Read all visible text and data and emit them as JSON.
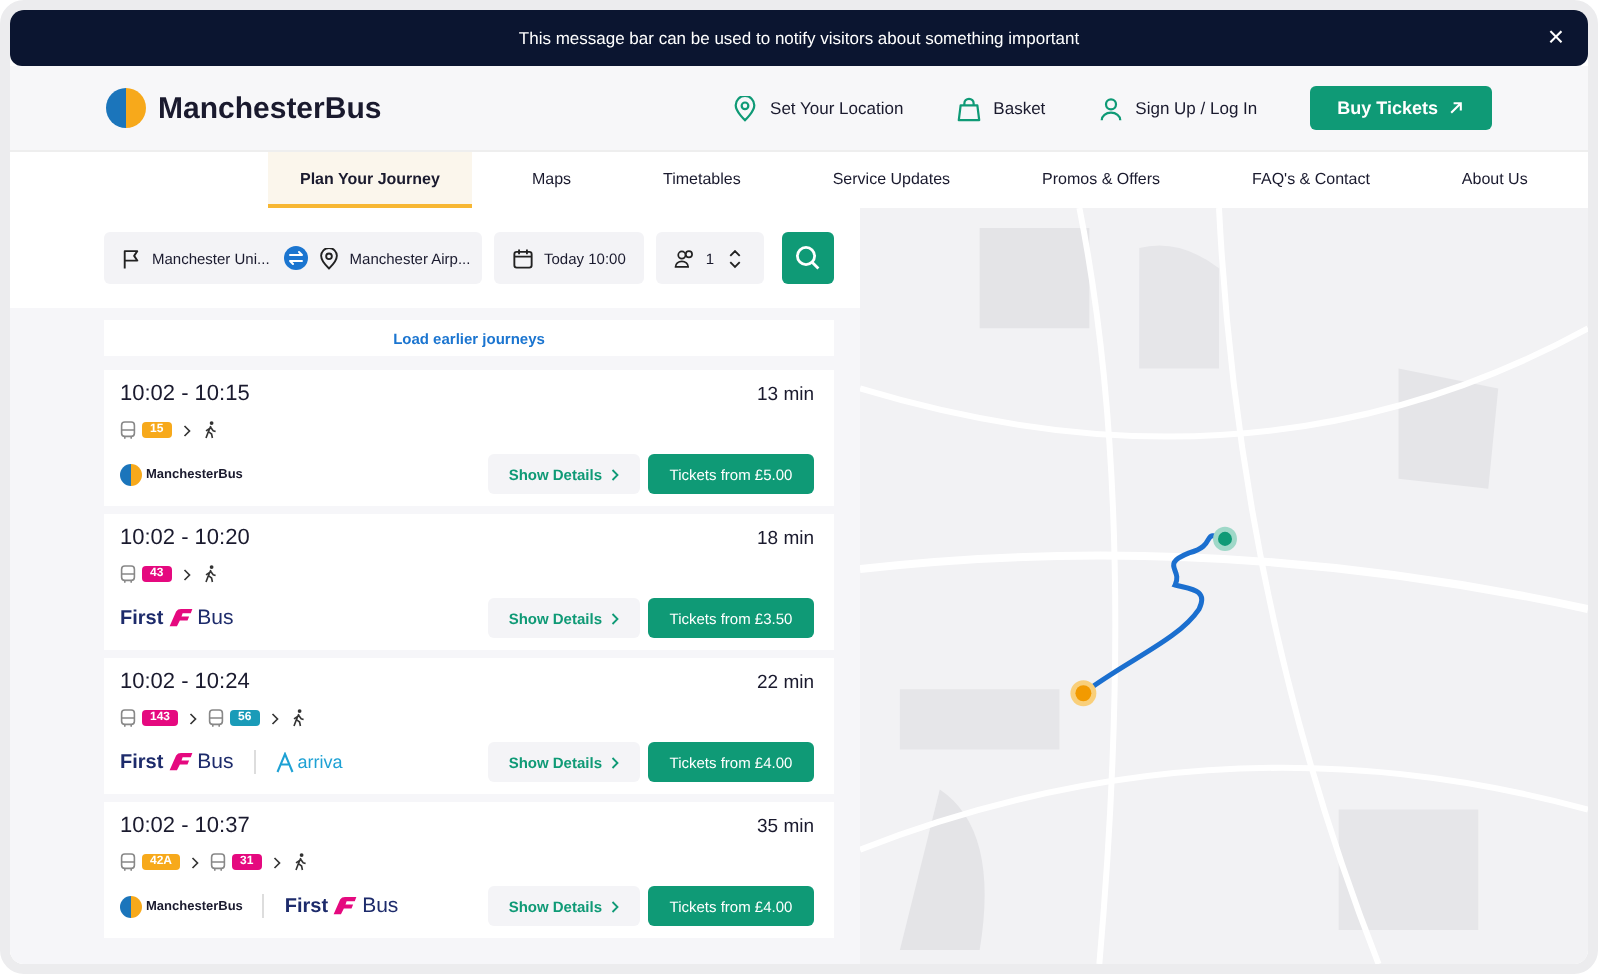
{
  "message_bar": {
    "text": "This message bar can be used to notify visitors about something important",
    "close": "×"
  },
  "header": {
    "brand": "ManchesterBus",
    "links": [
      {
        "kind": "location",
        "label": "Set Your Location"
      },
      {
        "kind": "basket",
        "label": "Basket"
      },
      {
        "kind": "user",
        "label": "Sign Up / Log In"
      }
    ],
    "cta": "Buy Tickets"
  },
  "nav": [
    {
      "label": "Plan Your Journey",
      "selected": true
    },
    {
      "label": "Maps",
      "selected": false
    },
    {
      "label": "Timetables",
      "selected": false
    },
    {
      "label": "Service Updates",
      "selected": false
    },
    {
      "label": "Promos & Offers",
      "selected": false
    },
    {
      "label": "FAQ's & Contact",
      "selected": false
    },
    {
      "label": "About Us",
      "selected": false
    }
  ],
  "search": {
    "from": "Manchester Uni...",
    "to": "Manchester Airp...",
    "when": "Today 10:00",
    "passengers": "1"
  },
  "load_earlier": "Load earlier journeys",
  "journeys": [
    {
      "times": "10:02 - 10:15",
      "duration": "13 min",
      "legs": [
        {
          "kind": "bus",
          "route": "15",
          "color": "#f7a91b"
        },
        {
          "kind": "walk"
        }
      ],
      "operators": [
        {
          "kind": "manchesterbus",
          "name": "ManchesterBus"
        }
      ],
      "details": "Show Details",
      "tickets": "Tickets from £5.00"
    },
    {
      "times": "10:02 - 10:20",
      "duration": "18 min",
      "legs": [
        {
          "kind": "bus",
          "route": "43",
          "color": "#e5097f"
        },
        {
          "kind": "walk"
        }
      ],
      "operators": [
        {
          "kind": "firstbus",
          "parts": [
            "First",
            "Bus"
          ]
        }
      ],
      "details": "Show Details",
      "tickets": "Tickets from £3.50"
    },
    {
      "times": "10:02 - 10:24",
      "duration": "22 min",
      "legs": [
        {
          "kind": "bus",
          "route": "143",
          "color": "#e5097f"
        },
        {
          "kind": "bus",
          "route": "56",
          "color": "#1a9bb8"
        },
        {
          "kind": "walk"
        }
      ],
      "operators": [
        {
          "kind": "firstbus",
          "parts": [
            "First",
            "Bus"
          ]
        },
        {
          "kind": "arriva",
          "name": "arriva"
        }
      ],
      "details": "Show Details",
      "tickets": "Tickets from £4.00"
    },
    {
      "times": "10:02 - 10:37",
      "duration": "35 min",
      "legs": [
        {
          "kind": "bus",
          "route": "42A",
          "color": "#f7a91b"
        },
        {
          "kind": "bus",
          "route": "31",
          "color": "#e5097f"
        },
        {
          "kind": "walk"
        }
      ],
      "operators": [
        {
          "kind": "manchesterbus",
          "name": "ManchesterBus"
        },
        {
          "kind": "firstbus",
          "parts": [
            "First",
            "Bus"
          ]
        }
      ],
      "details": "Show Details",
      "tickets": "Tickets from £4.00"
    }
  ]
}
